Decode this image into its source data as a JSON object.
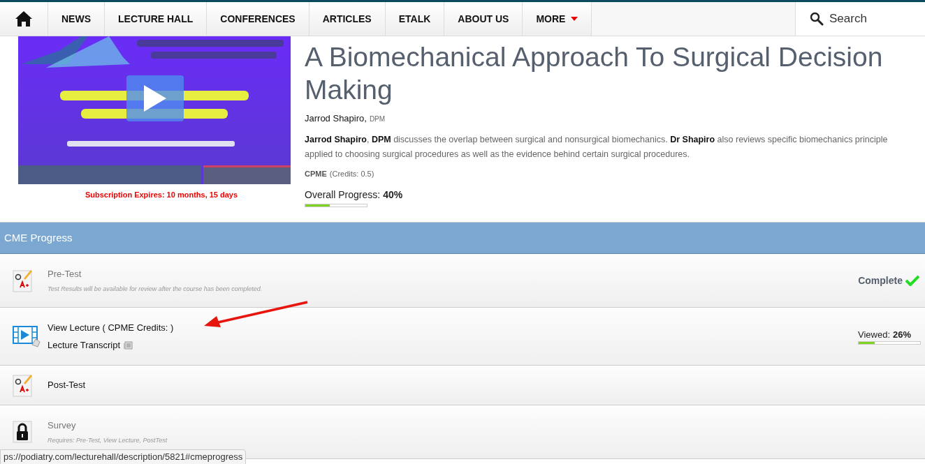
{
  "nav": {
    "items": [
      {
        "label": "NEWS",
        "dropdown": false
      },
      {
        "label": "LECTURE HALL",
        "dropdown": false
      },
      {
        "label": "CONFERENCES",
        "dropdown": false
      },
      {
        "label": "ARTICLES",
        "dropdown": false
      },
      {
        "label": "ETALK",
        "dropdown": false
      },
      {
        "label": "ABOUT US",
        "dropdown": false
      },
      {
        "label": "MORE",
        "dropdown": true
      }
    ],
    "search": {
      "placeholder": "Search"
    }
  },
  "lecture": {
    "subscription": "Subscription Expires: 10 months, 15 days",
    "title": "A Biomechanical Approach To Surgical Decision Making",
    "author": "Jarrod Shapiro,",
    "degree": "DPM",
    "description_lines": [
      "**Jarrod Shapiro**, **DPM** discusses the overlap between surgical and nonsurgical biomechanics. **Dr Shapiro** also reviews specific biomechanics principle",
      "applied to choosing surgical procedures as well as the evidence behind certain surgical procedures."
    ],
    "credit_type": "CPME",
    "credits": "(Credits: 0.5)",
    "progress_label": "Overall Progress:",
    "progress_value": "40%",
    "level": 0.4
  },
  "cme": {
    "title": "CME Progress",
    "rows": [
      {
        "kind": "quiz",
        "title": "Pre-Test",
        "dimmed": true,
        "note": "Test Results will be available for review after the course has been completed.",
        "status": {
          "kind": "complete",
          "label": "Complete"
        }
      },
      {
        "kind": "video",
        "title": "View Lecture ( CPME Credits: )",
        "dimmed": false,
        "link": "Lecture Transcript",
        "status": {
          "kind": "viewed",
          "label": "Viewed:",
          "value": "26%",
          "level": 0.26
        }
      },
      {
        "kind": "quiz",
        "title": "Post-Test",
        "dimmed": false
      },
      {
        "kind": "lock",
        "title": "Survey",
        "dimmed": true,
        "note": "*Requires:* Pre-Test, View Lecture, PostTest"
      }
    ]
  },
  "status_url": "ps://podiatry.com/lecturehall/description/5821#cmeprogress"
}
